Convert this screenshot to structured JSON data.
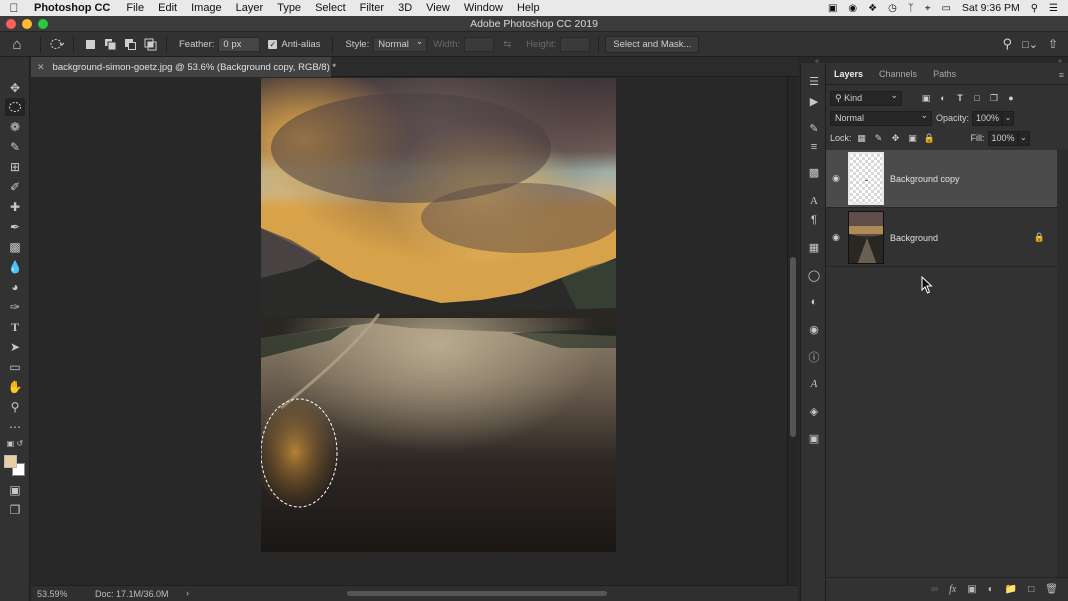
{
  "menubar": {
    "app_name": "Photoshop CC",
    "items": [
      "File",
      "Edit",
      "Image",
      "Layer",
      "Type",
      "Select",
      "Filter",
      "3D",
      "View",
      "Window",
      "Help"
    ],
    "clock": "Sat 9:36 PM"
  },
  "window": {
    "title": "Adobe Photoshop CC 2019"
  },
  "options": {
    "feather_label": "Feather:",
    "feather_value": "0 px",
    "anti_alias_label": "Anti-alias",
    "anti_alias_checked": true,
    "style_label": "Style:",
    "style_value": "Normal",
    "width_label": "Width:",
    "height_label": "Height:",
    "select_mask_label": "Select and Mask..."
  },
  "document": {
    "tab_title": "background-simon-goetz.jpg @ 53.6% (Background copy, RGB/8) *",
    "zoom": "53.59%",
    "doc_info": "Doc: 17.1M/36.0M"
  },
  "colors": {
    "foreground": "#e7cfa3",
    "background": "#ffffff",
    "selected_layer": "#4b4b4b"
  },
  "layers_panel": {
    "tabs": [
      "Layers",
      "Channels",
      "Paths"
    ],
    "active_tab": "Layers",
    "filter_kind": "Kind",
    "blend_mode": "Normal",
    "opacity_label": "Opacity:",
    "opacity_value": "100%",
    "lock_label": "Lock:",
    "fill_label": "Fill:",
    "fill_value": "100%",
    "layers": [
      {
        "name": "Background copy",
        "visible": true,
        "selected": true,
        "locked": false
      },
      {
        "name": "Background",
        "visible": true,
        "selected": false,
        "locked": true
      }
    ]
  }
}
